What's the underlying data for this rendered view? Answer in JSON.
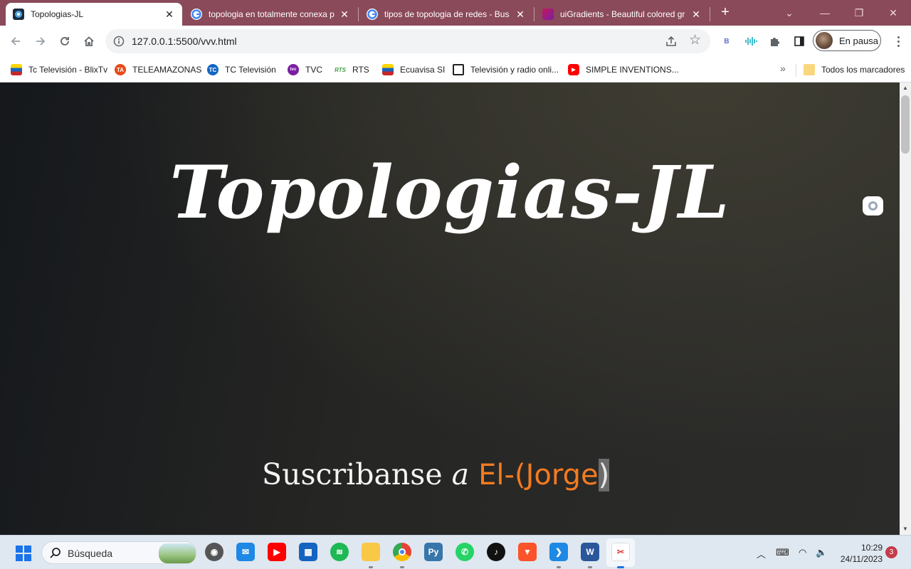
{
  "browser": {
    "tabs": [
      {
        "title": "Topologias-JL",
        "icon": "page-favicon",
        "active": true
      },
      {
        "title": "topologia en totalmente conexa p",
        "icon": "google-icon",
        "active": false
      },
      {
        "title": "tipos de topologia de redes - Bus",
        "icon": "google-icon",
        "active": false
      },
      {
        "title": "uiGradients - Beautiful colored gr",
        "icon": "uigradients-icon",
        "active": false
      }
    ],
    "new_tab": "+",
    "url": "127.0.0.1:5500/vvv.html",
    "profile_label": "En pausa",
    "accent_color": "#8a4a5a"
  },
  "bookmarks": {
    "items": [
      {
        "label": "Tc Televisión - BlixTv",
        "icon": "tc-television-icon",
        "color": "#c62828"
      },
      {
        "label": "TELEAMAZONAS",
        "icon": "teleamazonas-icon",
        "color": "#e65100"
      },
      {
        "label": "TC Televisión",
        "icon": "tc-globe-icon",
        "color": "#1565c0"
      },
      {
        "label": "TVC",
        "icon": "tvc-icon",
        "color": "#6a1b9a"
      },
      {
        "label": "RTS",
        "icon": "rts-icon",
        "color": "#2e7d32"
      },
      {
        "label": "Ecuavisa SI",
        "icon": "ecuavisa-icon",
        "color": "#b71c1c"
      },
      {
        "label": "Televisión y radio onli...",
        "icon": "tv-icon",
        "color": "#202124"
      },
      {
        "label": "SIMPLE INVENTIONS...",
        "icon": "youtube-icon",
        "color": "#ff0000"
      }
    ],
    "more": "»",
    "all_bookmarks": "Todos los marcadores"
  },
  "page": {
    "title": "Topologias-JL",
    "subscribe_text": "Suscribanse",
    "subscribe_a": "a",
    "subscribe_name": "El-(Jorge",
    "subscribe_caret": ")",
    "name_color": "#f47b20"
  },
  "taskbar": {
    "search_label": "Búsqueda",
    "time": "10:29",
    "date": "24/11/2023",
    "notification_count": "3"
  }
}
